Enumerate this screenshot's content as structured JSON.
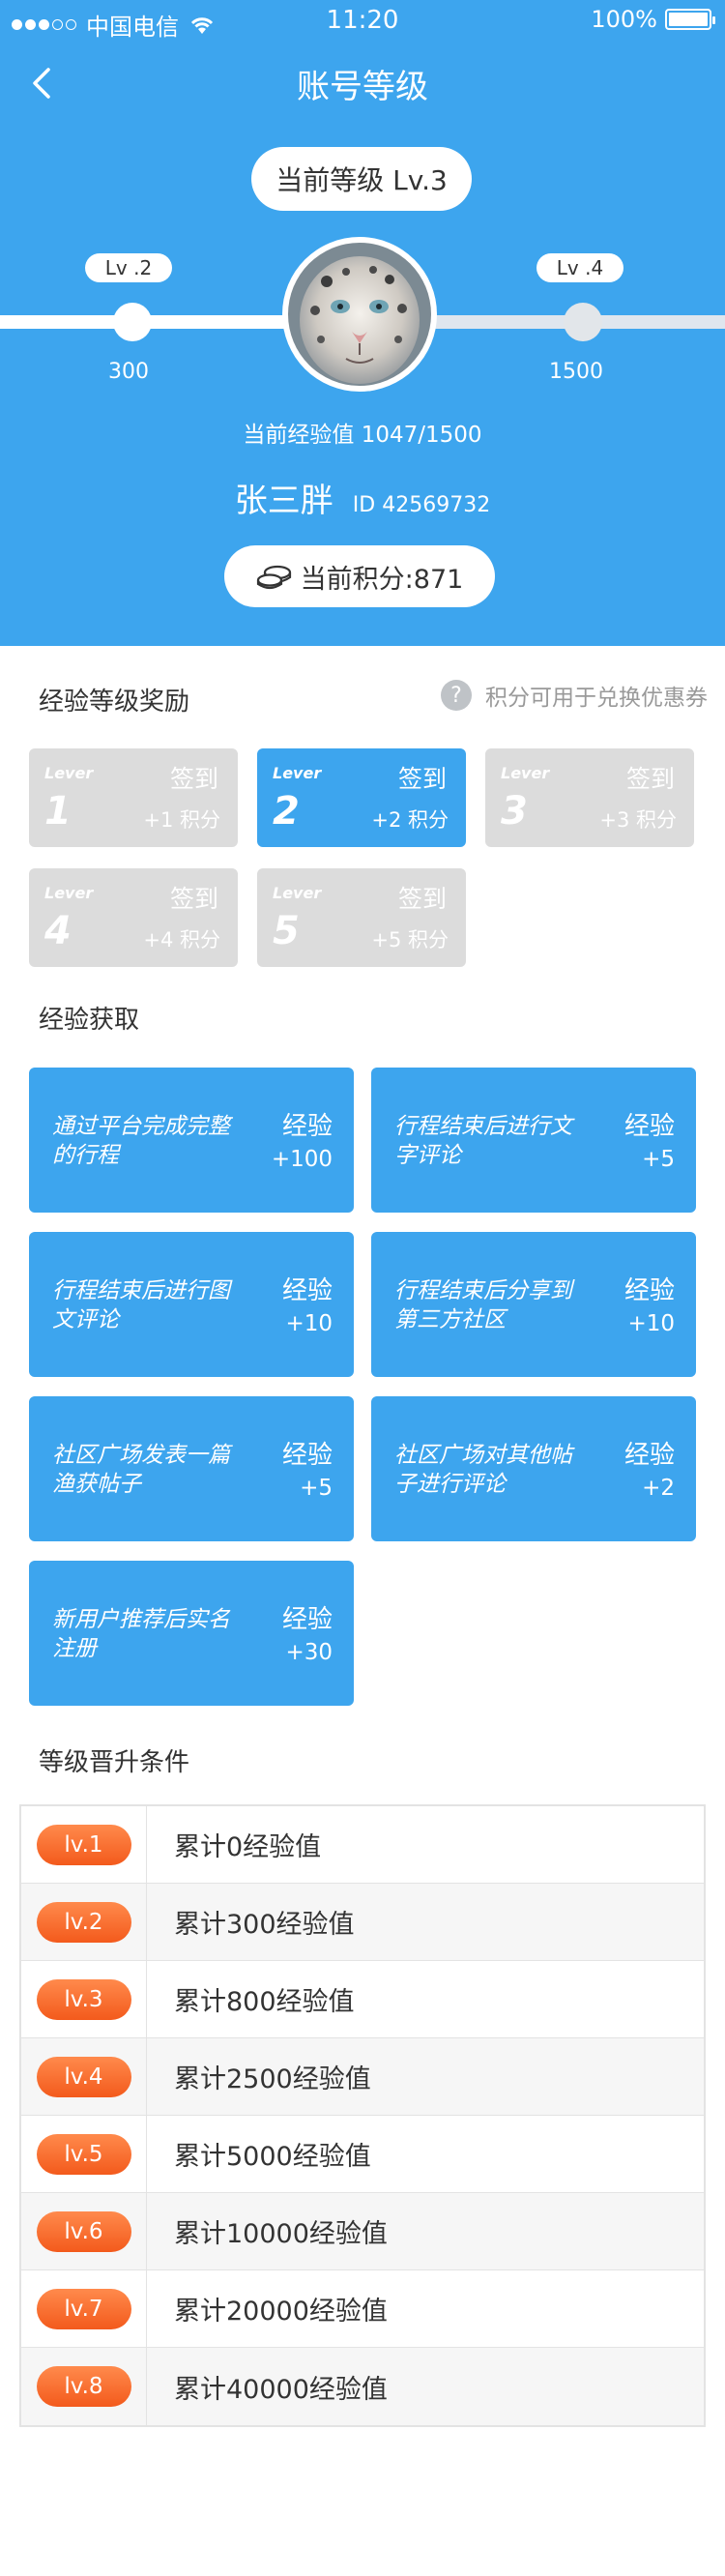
{
  "status_bar": {
    "carrier": "中国电信",
    "time": "11:20",
    "battery": "100%"
  },
  "nav": {
    "title": "账号等级"
  },
  "level": {
    "current_pill": "当前等级 Lv.3",
    "prev_tag": "Lv .2",
    "next_tag": "Lv .4",
    "prev_value": "300",
    "next_value": "1500",
    "exp_text": "当前经验值 1047/1500"
  },
  "user": {
    "name": "张三胖",
    "id": "ID  42569732"
  },
  "points": {
    "label": "当前积分:871"
  },
  "rewards_section": {
    "title": "经验等级奖励",
    "help_text": "积分可用于兑换优惠券",
    "help_icon": "?"
  },
  "rewards": [
    {
      "lever": "Lever",
      "num": "1",
      "sign": "签到",
      "bonus": "+1 积分",
      "active": false
    },
    {
      "lever": "Lever",
      "num": "2",
      "sign": "签到",
      "bonus": "+2 积分",
      "active": true
    },
    {
      "lever": "Lever",
      "num": "3",
      "sign": "签到",
      "bonus": "+3 积分",
      "active": false
    },
    {
      "lever": "Lever",
      "num": "4",
      "sign": "签到",
      "bonus": "+4 积分",
      "active": false
    },
    {
      "lever": "Lever",
      "num": "5",
      "sign": "签到",
      "bonus": "+5 积分",
      "active": false
    }
  ],
  "exp_section": {
    "title": "经验获取"
  },
  "exp_items": [
    {
      "desc": "通过平台完成完整的行程",
      "label": "经验",
      "value": "+100"
    },
    {
      "desc": "行程结束后进行文字评论",
      "label": "经验",
      "value": "+5"
    },
    {
      "desc": "行程结束后进行图文评论",
      "label": "经验",
      "value": "+10"
    },
    {
      "desc": "行程结束后分享到第三方社区",
      "label": "经验",
      "value": "+10"
    },
    {
      "desc": "社区广场发表一篇渔获帖子",
      "label": "经验",
      "value": "+5"
    },
    {
      "desc": "社区广场对其他帖子进行评论",
      "label": "经验",
      "value": "+2"
    },
    {
      "desc": "新用户推荐后实名注册",
      "label": "经验",
      "value": "+30"
    }
  ],
  "upgrade_section": {
    "title": "等级晋升条件"
  },
  "upgrade_rows": [
    {
      "level": "lv.1",
      "cond": "累计0经验值"
    },
    {
      "level": "lv.2",
      "cond": "累计300经验值"
    },
    {
      "level": "lv.3",
      "cond": "累计800经验值"
    },
    {
      "level": "lv.4",
      "cond": "累计2500经验值"
    },
    {
      "level": "lv.5",
      "cond": "累计5000经验值"
    },
    {
      "level": "lv.6",
      "cond": "累计10000经验值"
    },
    {
      "level": "lv.7",
      "cond": "累计20000经验值"
    },
    {
      "level": "lv.8",
      "cond": "累计40000经验值"
    }
  ],
  "colors": {
    "primary": "#3da5ee",
    "badge": "#f35a1c",
    "inactive": "#dcdcdc"
  }
}
